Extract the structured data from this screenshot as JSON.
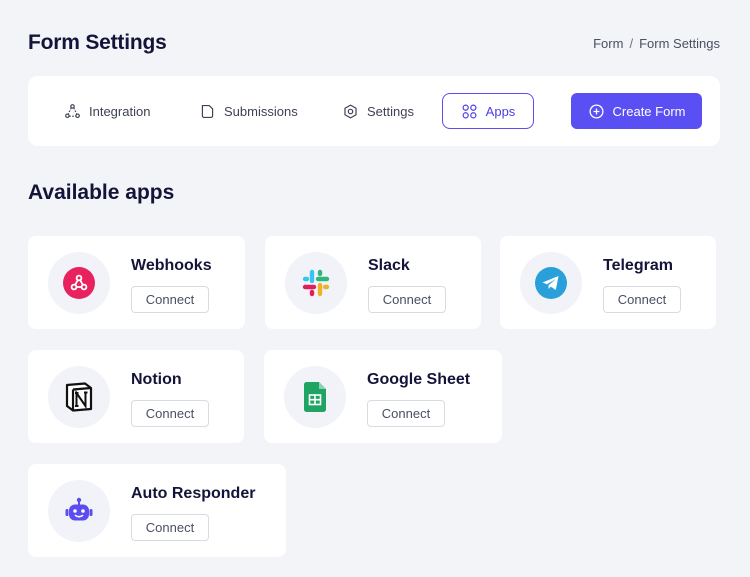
{
  "header": {
    "title": "Form Settings",
    "breadcrumb": [
      "Form",
      "/",
      "Form Settings"
    ]
  },
  "tabs": [
    {
      "label": "Integration",
      "icon": "integration-icon"
    },
    {
      "label": "Submissions",
      "icon": "document-icon"
    },
    {
      "label": "Settings",
      "icon": "gear-icon"
    },
    {
      "label": "Apps",
      "icon": "apps-grid-icon",
      "active": true
    }
  ],
  "create_button": {
    "label": "Create Form",
    "icon": "plus-circle-icon"
  },
  "section": {
    "title": "Available apps"
  },
  "apps": [
    {
      "name": "Webhooks",
      "action": "Connect",
      "icon": "webhooks-icon"
    },
    {
      "name": "Slack",
      "action": "Connect",
      "icon": "slack-icon"
    },
    {
      "name": "Telegram",
      "action": "Connect",
      "icon": "telegram-icon"
    },
    {
      "name": "Notion",
      "action": "Connect",
      "icon": "notion-icon"
    },
    {
      "name": "Google Sheet",
      "action": "Connect",
      "icon": "google-sheet-icon"
    },
    {
      "name": "Auto Responder",
      "action": "Connect",
      "icon": "robot-icon"
    }
  ],
  "colors": {
    "accent": "#5a4ff3",
    "background": "#f3f4f8",
    "webhooks": "#e8225f",
    "telegram": "#2aa0da",
    "google_sheet": "#1fa463",
    "robot": "#5b4df0"
  }
}
